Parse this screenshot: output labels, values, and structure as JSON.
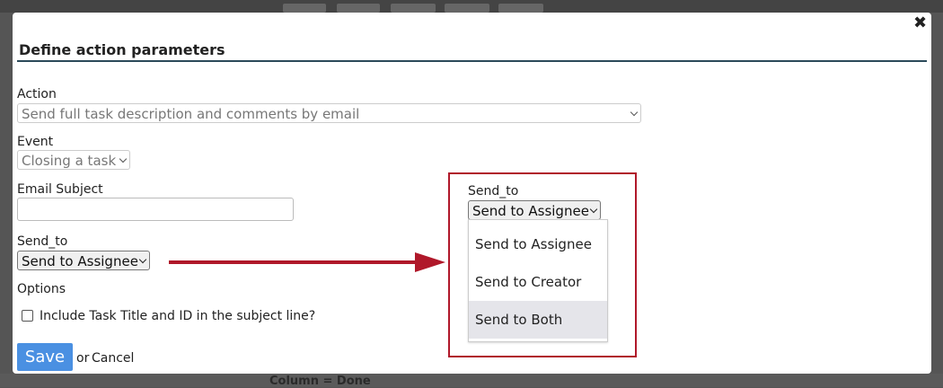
{
  "dialog": {
    "title": "Define action parameters",
    "close_symbol": "✖"
  },
  "form": {
    "action_label": "Action",
    "action_value": "Send full task description and comments by email",
    "event_label": "Event",
    "event_value": "Closing a task",
    "email_subject_label": "Email Subject",
    "email_subject_value": "",
    "send_to_label": "Send_to",
    "send_to_value": "Send to Assignee",
    "options_label": "Options",
    "checkbox_label": "Include Task Title and ID in the subject line?",
    "checkbox_checked": false
  },
  "footer": {
    "save_label": "Save",
    "or_text": "or",
    "cancel_label": "Cancel"
  },
  "callout": {
    "send_to_label": "Send_to",
    "send_to_value": "Send to Assignee",
    "options": [
      "Send to Assignee",
      "Send to Creator",
      "Send to Both"
    ],
    "highlighted_option": "Send to Both",
    "border_color": "#b0182a",
    "arrow_color": "#b0182a"
  },
  "background": {
    "partial_text": "Column = Done"
  }
}
